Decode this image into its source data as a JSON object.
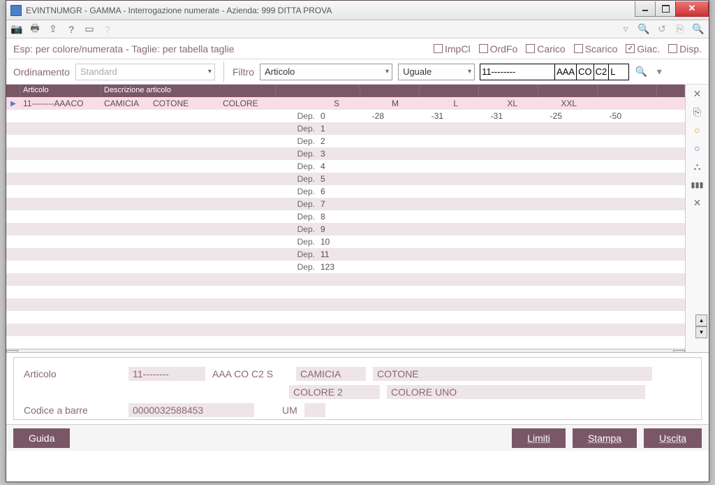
{
  "window": {
    "title": "EVINTNUMGR - GAMMA - Interrogazione numerate - Azienda:  999 DITTA PROVA"
  },
  "info": {
    "text": "Esp: per colore/numerata - Taglie: per tabella taglie"
  },
  "checks": {
    "impcl": "ImpCl",
    "ordfo": "OrdFo",
    "carico": "Carico",
    "scarico": "Scarico",
    "giac": "Giac.",
    "disp": "Disp."
  },
  "ordinamento": {
    "label": "Ordinamento",
    "value": "Standard"
  },
  "filtro": {
    "label": "Filtro",
    "field": "Articolo",
    "op": "Uguale",
    "val": "11--------",
    "segs": [
      "AAA",
      "CO",
      "C2",
      "L"
    ]
  },
  "grid": {
    "headers": {
      "articolo": "Articolo",
      "descrizione": "Descrizione articolo"
    },
    "row0": {
      "art": "11--------AAACO",
      "desc1": "CAMICIA",
      "desc2": "COTONE",
      "col": "COLORE",
      "sizes": [
        "S",
        "M",
        "L",
        "XL",
        "XXL"
      ]
    },
    "deps": [
      {
        "label": "Dep.",
        "n": "0",
        "vals": [
          "-28",
          "-31",
          "-31",
          "-25",
          "-50"
        ]
      },
      {
        "label": "Dep.",
        "n": "1",
        "vals": [
          "",
          "",
          "",
          "",
          ""
        ]
      },
      {
        "label": "Dep.",
        "n": "2",
        "vals": [
          "",
          "",
          "",
          "",
          ""
        ]
      },
      {
        "label": "Dep.",
        "n": "3",
        "vals": [
          "",
          "",
          "",
          "",
          ""
        ]
      },
      {
        "label": "Dep.",
        "n": "4",
        "vals": [
          "",
          "",
          "",
          "",
          ""
        ]
      },
      {
        "label": "Dep.",
        "n": "5",
        "vals": [
          "",
          "",
          "",
          "",
          ""
        ]
      },
      {
        "label": "Dep.",
        "n": "6",
        "vals": [
          "",
          "",
          "",
          "",
          ""
        ]
      },
      {
        "label": "Dep.",
        "n": "7",
        "vals": [
          "",
          "",
          "",
          "",
          ""
        ]
      },
      {
        "label": "Dep.",
        "n": "8",
        "vals": [
          "",
          "",
          "",
          "",
          ""
        ]
      },
      {
        "label": "Dep.",
        "n": "9",
        "vals": [
          "",
          "",
          "",
          "",
          ""
        ]
      },
      {
        "label": "Dep.",
        "n": "10",
        "vals": [
          "",
          "",
          "",
          "",
          ""
        ]
      },
      {
        "label": "Dep.",
        "n": "11",
        "vals": [
          "",
          "",
          "",
          "",
          ""
        ]
      },
      {
        "label": "Dep.",
        "n": "123",
        "vals": [
          "",
          "",
          "",
          "",
          ""
        ]
      }
    ]
  },
  "detail": {
    "articolo_label": "Articolo",
    "art1": "11--------",
    "art2": "AAA CO C2  S",
    "desc1": "CAMICIA",
    "desc2": "COTONE",
    "color1": "COLORE 2",
    "color2": "COLORE UNO",
    "barcode_label": "Codice a barre",
    "barcode": "0000032588453",
    "um_label": "UM"
  },
  "footer": {
    "guida": "Guida",
    "limiti": "Limiti",
    "stampa": "Stampa",
    "uscita": "Uscita"
  }
}
